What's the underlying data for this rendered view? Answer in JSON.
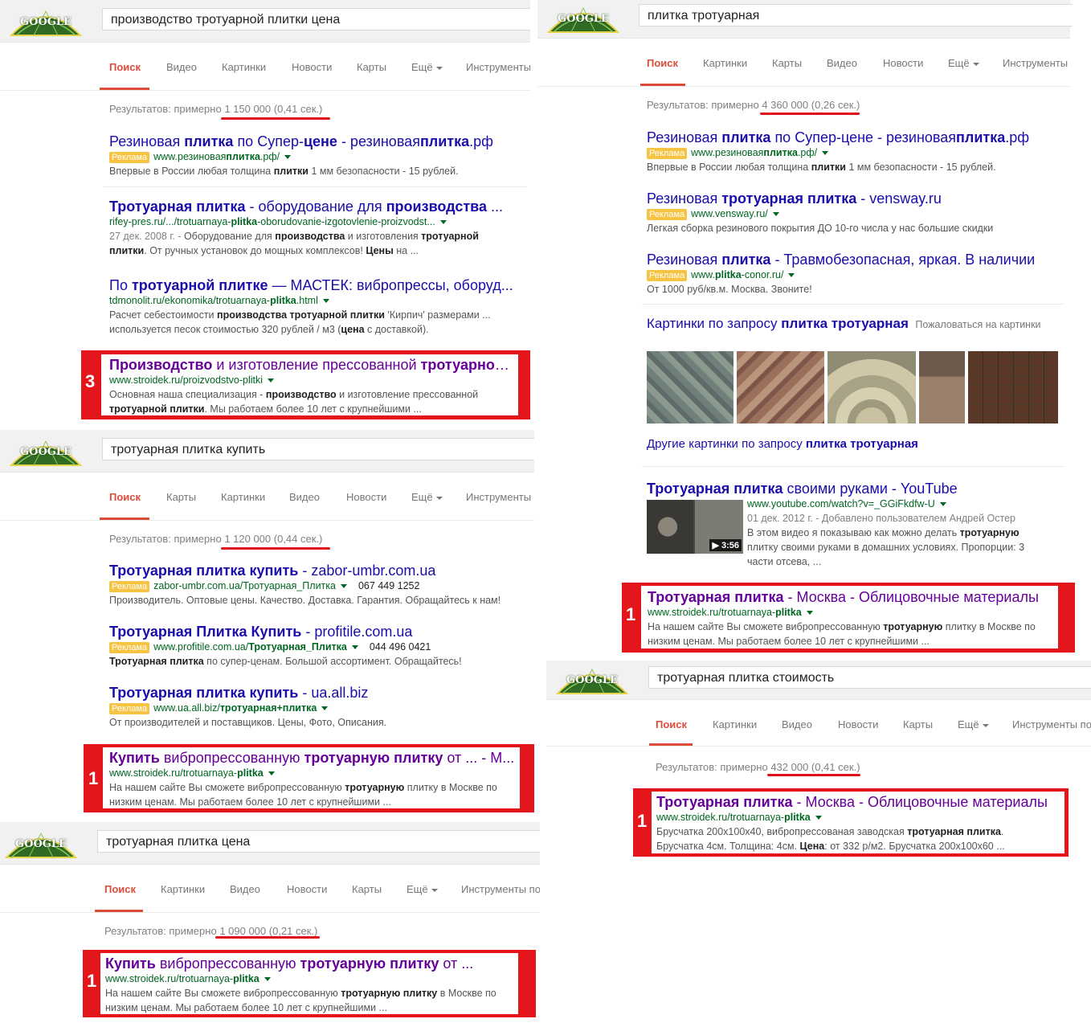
{
  "logo": "GOOGLE",
  "p1": {
    "query": "производство тротуарной плитки цена",
    "tabs": [
      "Поиск",
      "Видео",
      "Картинки",
      "Новости",
      "Карты",
      "Ещё",
      "Инструменты"
    ],
    "stats_prefix": "Результатов: примерно",
    "stats_value": "1 150 000 (0,41 сек.)",
    "r1": {
      "t1": "Резиновая ",
      "t2": "плитка",
      "t3": " по Супер-",
      "t4": "цене",
      "t5": " - резиновая",
      "t6": "плитка",
      ".rf": ".рф",
      "ad": "Реклама",
      "u1": "www.резиновая",
      "u2": "плитка",
      ".u3": ".рф/",
      "s1": "Впервые в России любая толщина ",
      "s2": "плитки",
      "s3": " 1 мм безопасности - 15 рублей."
    },
    "r2": {
      "t1": "Тротуарная плитка",
      "t2": " - оборудование для ",
      "t3": "производства",
      "t4": " ...",
      "u1": "rifey-pres.ru/.../trotuarnaya-",
      "u2": "plitka",
      "u3": "-oborudovanie-izgotovlenie-proizvodst...",
      "date": "27 дек. 2008 г. - ",
      "s1": "Оборудование для ",
      "s2": "производства",
      "s3": " и изготовления ",
      "s4": "тротуарной",
      "s5": "плитки",
      "s6": ". От ручных установок до мощных комплексов! ",
      "s7": "Цены",
      "s8": " на ..."
    },
    "r3": {
      "t1": "По ",
      "t2": "тротуарной плитке",
      "t3": " — МАСТЕК: вибропрессы, оборуд...",
      "u1": "tdmonolit.ru/ekonomika/trotuarnaya-",
      "u2": "plitka",
      ".u3": ".html",
      "s1": "Расчет себестоимости ",
      "s2": "производства тротуарной плитки",
      "s3": " 'Кирпич' размерами ...",
      "s4": "используется песок стоимостью 320 рублей / м3 (",
      "s5": "цена",
      "s6": " с доставкой)."
    },
    "r4": {
      "num": "3",
      "t1": "Производство",
      "t2": " и изготовление прессованной ",
      "t3": "тротуарной",
      "t4": "...",
      "u1": "www.stroidek.ru/proizvodstvo-plitki",
      "s1": "Основная наша специализация - ",
      "s2": "производство",
      "s3": " и изготовление прессованной",
      "s4": "тротуарной плитки",
      "s5": ". Мы работаем более 10 лет с крупнейшими ..."
    }
  },
  "p2": {
    "query": "тротуарная плитка купить",
    "tabs": [
      "Поиск",
      "Карты",
      "Картинки",
      "Видео",
      "Новости",
      "Ещё",
      "Инструменты"
    ],
    "stats_prefix": "Результатов: примерно",
    "stats_value": "1 120 000 (0,44 сек.)",
    "r1": {
      "t1": "Тротуарная плитка купить",
      "t2": " - zabor-umbr.com.ua",
      "ad": "Реклама",
      "u1": "zabor-umbr.com.ua/Тротуарная_Плитка",
      "ph": "067 449 1252",
      "s1": "Производитель. Оптовые цены. Качество. Доставка. Гарантия. Обращайтесь к нам!"
    },
    "r2": {
      "t1": "Тротуарная Плитка Купить",
      "t2": " - profitile.com.ua",
      "ad": "Реклама",
      "u1": "www.profitile.com.ua/",
      "u2": "Тротуарная_Плитка",
      "ph": "044 496 0421",
      "s1": "Тротуарная плитка",
      "s2": " по супер-ценам. Большой ассортимент. Обращайтесь!"
    },
    "r3": {
      "t1": "Тротуарная плитка купить",
      "t2": " - ua.all.biz",
      "ad": "Реклама",
      "u1": "www.ua.all.biz/",
      "u2": "тротуарная+плитка",
      "s1": "От производителей и поставщиков. Цены, Фото, Описания."
    },
    "r4": {
      "num": "1",
      "t1": "Купить",
      "t2": " вибропрессованную ",
      "t3": "тротуарную плитку",
      "t4": " от ... - М...",
      "u1": "www.stroidek.ru/trotuarnaya-",
      "u2": "plitka",
      "s1": "На нашем сайте Вы сможете вибропрессованную ",
      "s2": "тротуарную",
      "s3": " плитку в Москве по",
      "s4": "низким ценам. Мы работаем более 10 лет с крупнейшими ..."
    }
  },
  "p3": {
    "query": "тротуарная плитка цена",
    "tabs": [
      "Поиск",
      "Картинки",
      "Видео",
      "Новости",
      "Карты",
      "Ещё",
      "Инструменты по"
    ],
    "stats_prefix": "Результатов: примерно",
    "stats_value": "1 090 000 (0,21 сек.)",
    "r1": {
      "num": "1",
      "t1": "Купить",
      "t2": " вибропрессованную ",
      "t3": "тротуарную плитку",
      "t4": " от ...",
      "u1": "www.stroidek.ru/trotuarnaya-",
      "u2": "plitka",
      "s1": "На нашем сайте Вы сможете вибропрессованную ",
      "s2": "тротуарную плитку",
      "s3": " в Москве по",
      "s4": "низким ценам. Мы работаем более 10 лет с крупнейшими ..."
    }
  },
  "p4": {
    "query": "плитка тротуарная",
    "tabs": [
      "Поиск",
      "Картинки",
      "Карты",
      "Видео",
      "Новости",
      "Ещё",
      "Инструменты"
    ],
    "stats_prefix": "Результатов: примерно",
    "stats_value": "4 360 000 (0,26 сек.)",
    "r1": {
      "t1": "Резиновая ",
      "t2": "плитка",
      "t3": " по Супер-цене - резиновая",
      "t4": "плитка",
      ".t5": ".рф",
      "ad": "Реклама",
      "u1": "www.резиновая",
      "u2": "плитка",
      ".u3": ".рф/",
      "s1": "Впервые в России любая толщина ",
      "s2": "плитки",
      "s3": " 1 мм безопасности - 15 рублей."
    },
    "r2": {
      "t1": "Резиновая ",
      "t2": "тротуарная плитка",
      "t3": " - vensway.ru",
      "ad": "Реклама",
      "u1": "www.vensway.ru/",
      "s1": "Легкая сборка резинового покрытия ДО 10-го числа у нас большие скидки"
    },
    "r3": {
      "t1": "Резиновая ",
      "t2": "плитка",
      "t3": " - Травмобезопасная, яркая. В наличии",
      "ad": "Реклама",
      "u1": "www.",
      "u2": "plitka",
      "u3": "-conor.ru/",
      "s1": "От 1000 руб/кв.м. Москва. Звоните!"
    },
    "images": {
      "t1": "Картинки по запросу ",
      "t2": "плитка тротуарная",
      "report": "Пожаловаться на картинки",
      "more1": "Другие картинки по запросу ",
      "more2": "плитка тротуарная"
    },
    "video": {
      "t1": "Тротуарная плитка",
      "t2": " своими руками - YouTube",
      "u1": "www.youtube.com/watch?v=_GGiFkdfw-U",
      "date": "01 дек. 2012 г. - Добавлено пользователем Андрей Остер",
      "s1": "В этом видео я показываю как можно делать ",
      "s2": "тротуарную",
      "s3": "плитку своими руками в домашних условиях. Пропорции: 3",
      "s4": "части отсева, ...",
      "duration": "3:56"
    },
    "r4": {
      "num": "1",
      "t1": "Тротуарная плитка",
      "t2": " - Москва - Облицовочные материалы",
      "u1": "www.stroidek.ru/trotuarnaya-",
      "u2": "plitka",
      "s1": "На нашем сайте Вы сможете вибропрессованную ",
      "s2": "тротуарную",
      "s3": " плитку в Москве по",
      "s4": "низким ценам. Мы работаем более 10 лет с крупнейшими ..."
    }
  },
  "p5": {
    "query": "тротуарная плитка стоимость",
    "tabs": [
      "Поиск",
      "Картинки",
      "Видео",
      "Новости",
      "Карты",
      "Ещё",
      "Инструменты по"
    ],
    "stats_prefix": "Результатов: примерно",
    "stats_value": "432 000 (0,41 сек.)",
    "r1": {
      "num": "1",
      "t1": "Тротуарная плитка",
      "t2": " - Москва - Облицовочные материалы",
      "u1": "www.stroidek.ru/trotuarnaya-",
      "u2": "plitka",
      "s1": "Брусчатка 200х100х40, вибропрессованая заводская ",
      "s2": "тротуарная плитка",
      "s3": ".",
      "s4": "Брусчатка 4см. Толщина: 4см. ",
      "s5": "Цена",
      "s6": ": от 332 р/м2. Брусчатка 200х100х60 ..."
    }
  },
  "colors": {
    "accent": "#dd4b39",
    "link": "#1a0dab",
    "visited": "#660099",
    "url": "#006621",
    "highlight": "#e3161c",
    "ad_badge": "#f6c343"
  }
}
